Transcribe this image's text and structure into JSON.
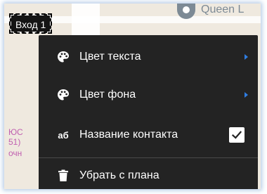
{
  "map": {
    "place_label": "Queen L",
    "poi_lines": [
      "ЮС",
      "51)",
      "очн"
    ]
  },
  "entrance_marker": {
    "label": "Вход 1"
  },
  "context_menu": {
    "items": [
      {
        "label": "Цвет текста",
        "icon": "palette-icon",
        "has_submenu": true
      },
      {
        "label": "Цвет фона",
        "icon": "palette-icon",
        "has_submenu": true
      },
      {
        "label": "Название контакта",
        "icon_text": "аб",
        "checked": true
      },
      {
        "label": "Убрать с плана",
        "icon": "trash-icon"
      }
    ],
    "accent_color": "#2f7de1"
  }
}
